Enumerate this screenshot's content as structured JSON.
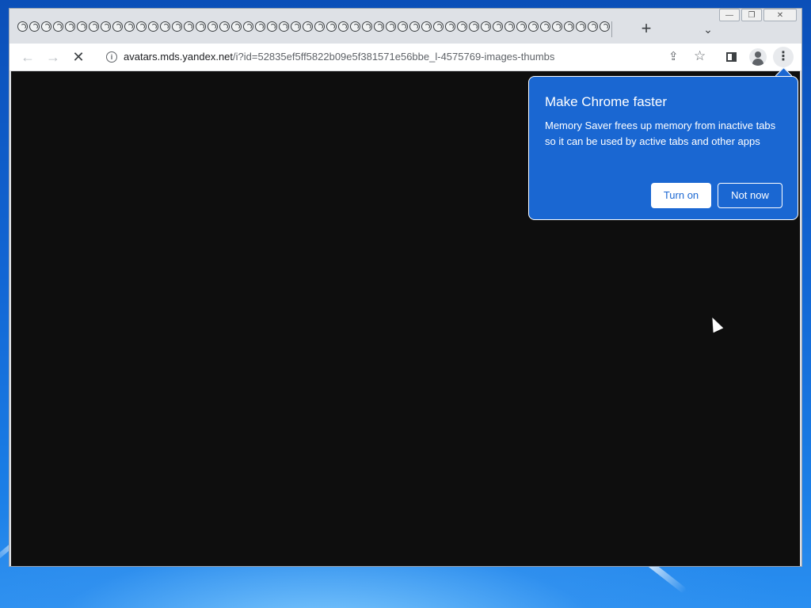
{
  "browser": {
    "tab_count": 50,
    "newtab_label": "+",
    "tab_search_label": "⌄",
    "window_controls": {
      "minimize": "—",
      "restore": "❐",
      "close": "✕"
    }
  },
  "toolbar": {
    "back_label": "←",
    "forward_label": "→",
    "reload_label": "✕",
    "url_host": "avatars.mds.yandex.net",
    "url_path": "/i?id=52835ef5ff5822b09e5f381571e56bbe_l-4575769-images-thumbs",
    "info_icon_label": "i",
    "share_label": "⇪",
    "star_label": "☆",
    "menu_label": "⋮"
  },
  "promo_bubble": {
    "title": "Make Chrome faster",
    "body": "Memory Saver frees up memory from inactive tabs so it can be used by active tabs and other apps",
    "turn_on_label": "Turn on",
    "not_now_label": "Not now",
    "background_color": "#1a67d2"
  },
  "content": {
    "background_color": "#0e0e0e"
  }
}
